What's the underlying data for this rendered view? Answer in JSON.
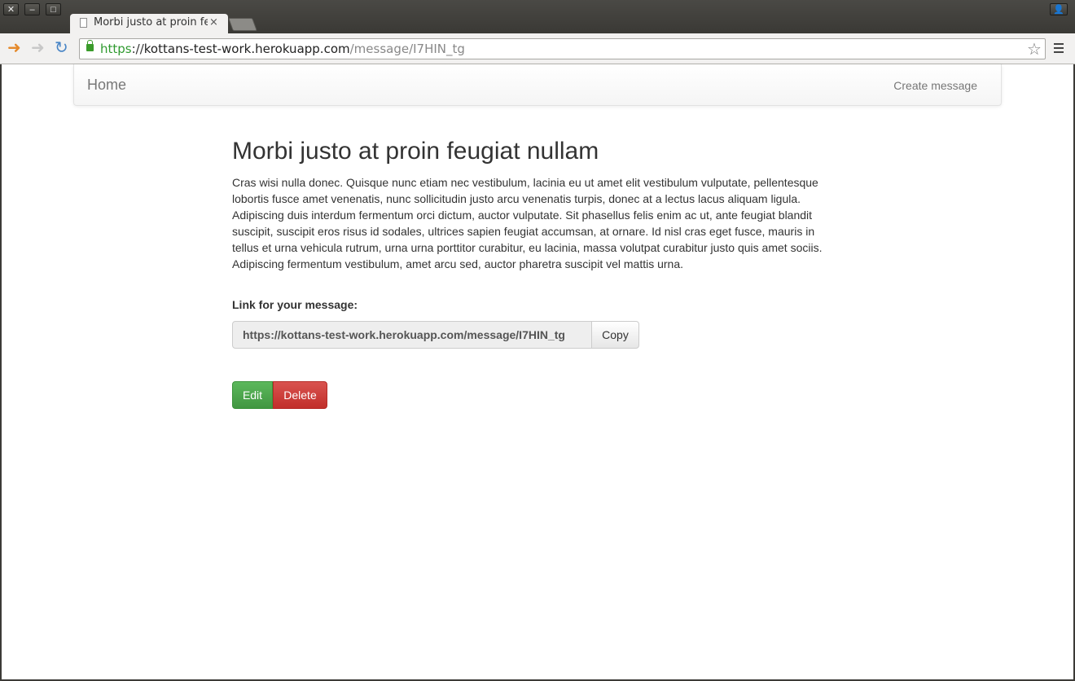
{
  "browser": {
    "tab_title": "Morbi justo at proin feugiat nullam",
    "tab_close": "×",
    "url_scheme": "https",
    "url_sep": "://",
    "url_host": "kottans-test-work.herokuapp.com",
    "url_path": "/message/I7HIN_tg"
  },
  "navbar": {
    "brand": "Home",
    "create_link": "Create message"
  },
  "message": {
    "title": "Morbi justo at proin feugiat nullam",
    "body": "Cras wisi nulla donec. Quisque nunc etiam nec vestibulum, lacinia eu ut amet elit vestibulum vulputate, pellentesque lobortis fusce amet venenatis, nunc sollicitudin justo arcu venenatis turpis, donec at a lectus lacus aliquam ligula. Adipiscing duis interdum fermentum orci dictum, auctor vulputate. Sit phasellus felis enim ac ut, ante feugiat blandit suscipit, suscipit eros risus id sodales, ultrices sapien feugiat accumsan, at ornare. Id nisl cras eget fusce, mauris in tellus et urna vehicula rutrum, urna urna porttitor curabitur, eu lacinia, massa volutpat curabitur justo quis amet sociis. Adipiscing fermentum vestibulum, amet arcu sed, auctor pharetra suscipit vel mattis urna.",
    "link_label": "Link for your message:",
    "link_value": "https://kottans-test-work.herokuapp.com/message/I7HIN_tg",
    "copy_label": "Copy",
    "edit_label": "Edit",
    "delete_label": "Delete"
  }
}
